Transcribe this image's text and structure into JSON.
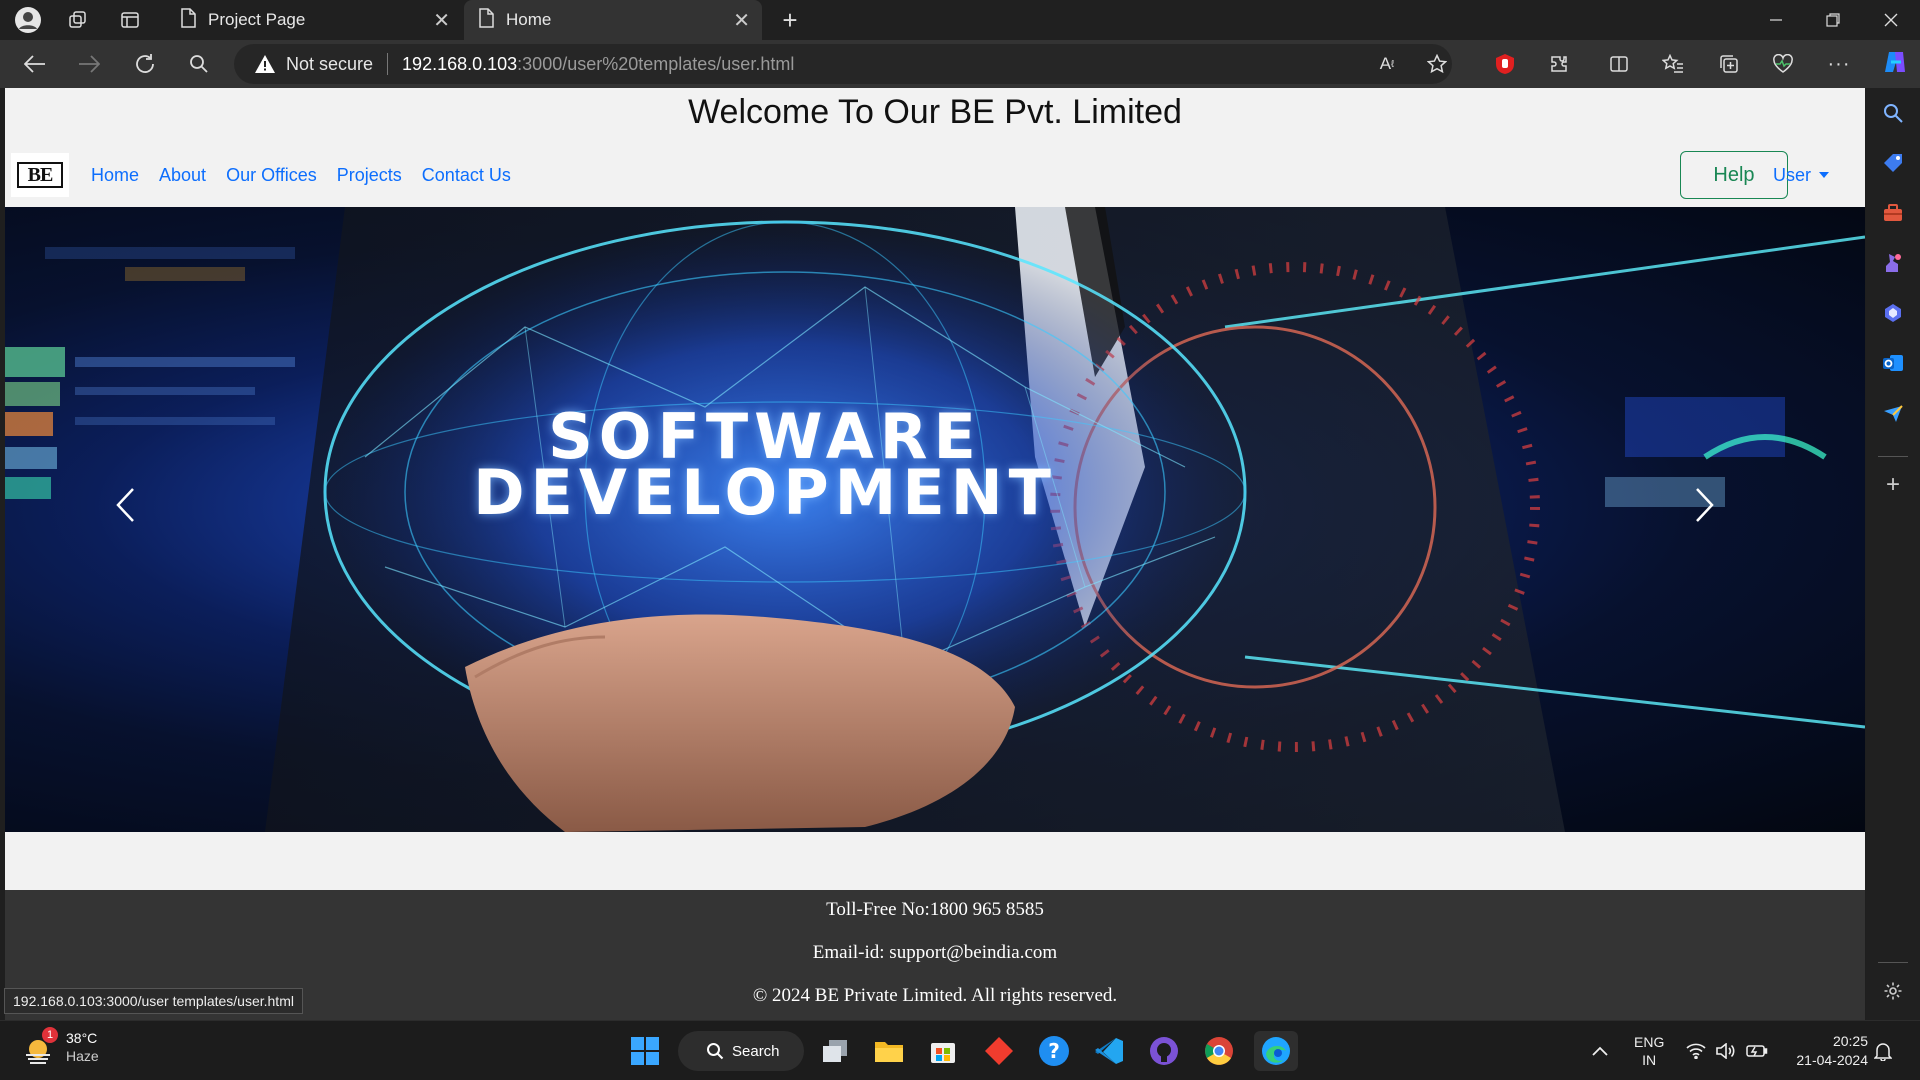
{
  "browser": {
    "tabs": [
      {
        "label": "Project Page",
        "active": false
      },
      {
        "label": "Home",
        "active": true
      }
    ],
    "security_label": "Not secure",
    "url_host": "192.168.0.103",
    "url_path": ":3000/user%20templates/user.html",
    "status_url": "192.168.0.103:3000/user templates/user.html"
  },
  "page": {
    "welcome_title": "Welcome To Our BE Pvt. Limited",
    "brand_text": "BE",
    "nav_links": [
      "Home",
      "About",
      "Our Offices",
      "Projects",
      "Contact Us"
    ],
    "help_label": "Help",
    "user_label": "User",
    "hero_line1": "SOFTWARE",
    "hero_line2": "DEVELOPMENT",
    "footer": {
      "toll_free": "Toll-Free No:1800 965 8585",
      "email": "Email-id: support@beindia.com",
      "copyright": "© 2024 BE Private Limited. All rights reserved."
    }
  },
  "taskbar": {
    "weather_temp": "38°C",
    "weather_desc": "Haze",
    "weather_badge": "1",
    "search_label": "Search",
    "lang_line1": "ENG",
    "lang_line2": "IN",
    "time": "20:25",
    "date": "21-04-2024"
  },
  "colors": {
    "link": "#0d6efd",
    "help_border": "#198754",
    "footer_bg": "#343434",
    "taskbar_bg": "#1c1c1c"
  }
}
